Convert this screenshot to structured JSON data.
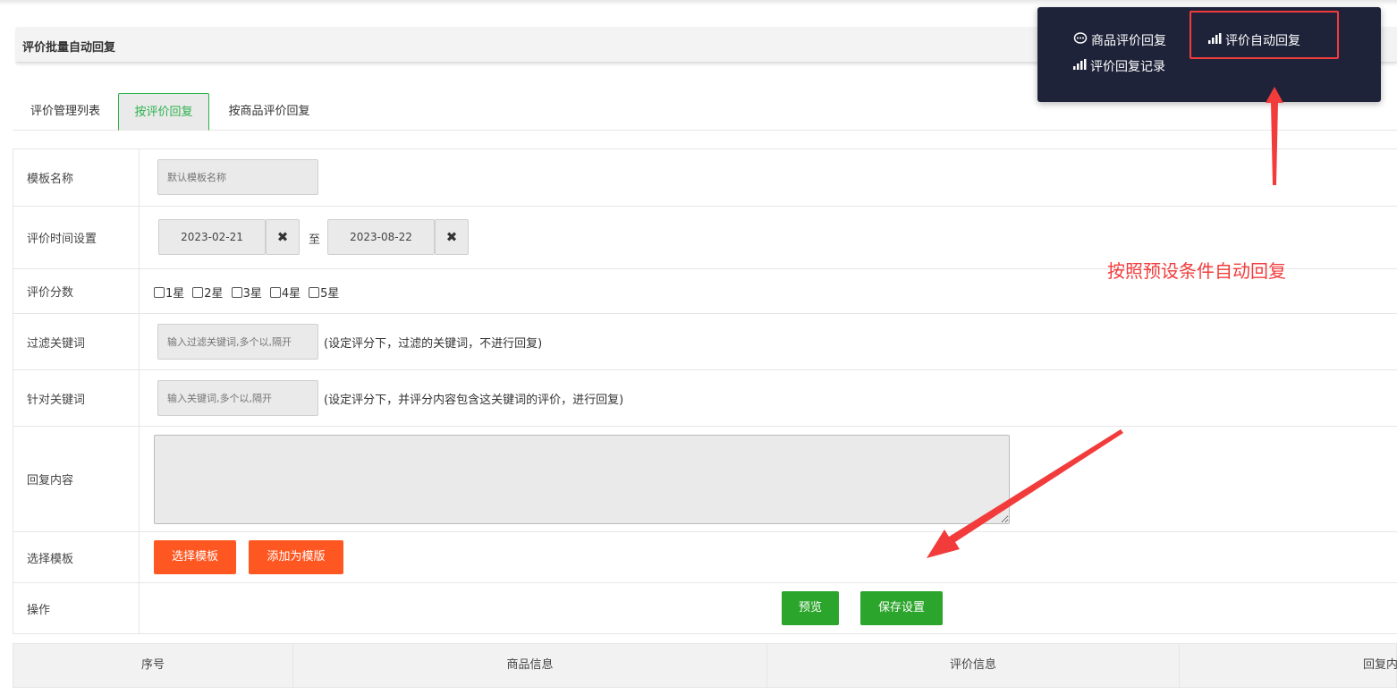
{
  "page": {
    "section_title": "评价批量自动回复"
  },
  "tabs": [
    "评价管理列表",
    "按评价回复",
    "按商品评价回复"
  ],
  "form": {
    "template_name": {
      "label": "模板名称",
      "placeholder": "默认模板名称"
    },
    "time": {
      "label": "评价时间设置",
      "start": "2023-02-21",
      "end": "2023-08-22",
      "to": "至",
      "clear_icon": "close-icon"
    },
    "score": {
      "label": "评价分数",
      "options": [
        "1星",
        "2星",
        "3星",
        "4星",
        "5星"
      ]
    },
    "filter_kw": {
      "label": "过滤关键词",
      "placeholder": "输入过滤关键词,多个以,隔开",
      "hint": "(设定评分下，过滤的关键词，不进行回复)"
    },
    "target_kw": {
      "label": "针对关键词",
      "placeholder": "输入关键词,多个以,隔开",
      "hint": "(设定评分下，并评分内容包含这关键词的评价，进行回复)"
    },
    "reply": {
      "label": "回复内容"
    },
    "template": {
      "label": "选择模板",
      "choose": "选择模板",
      "add": "添加为模版"
    },
    "ops": {
      "label": "操作",
      "preview": "预览",
      "save": "保存设置"
    }
  },
  "table": {
    "headers": [
      "序号",
      "商品信息",
      "评价信息",
      "回复内"
    ]
  },
  "popup": {
    "items": [
      {
        "label": "商品评价回复",
        "icon": "chat-icon"
      },
      {
        "label": "评价自动回复",
        "icon": "bar-chart-icon"
      },
      {
        "label": "评价回复记录",
        "icon": "bar-chart-icon"
      }
    ]
  },
  "annotation": {
    "text": "按照预设条件自动回复"
  },
  "colors": {
    "accent_green": "#2bb24c",
    "button_orange": "#ff5722",
    "button_green": "#2ba52b",
    "popup_bg": "#1f2339",
    "annotation_red": "#f23c3c"
  }
}
